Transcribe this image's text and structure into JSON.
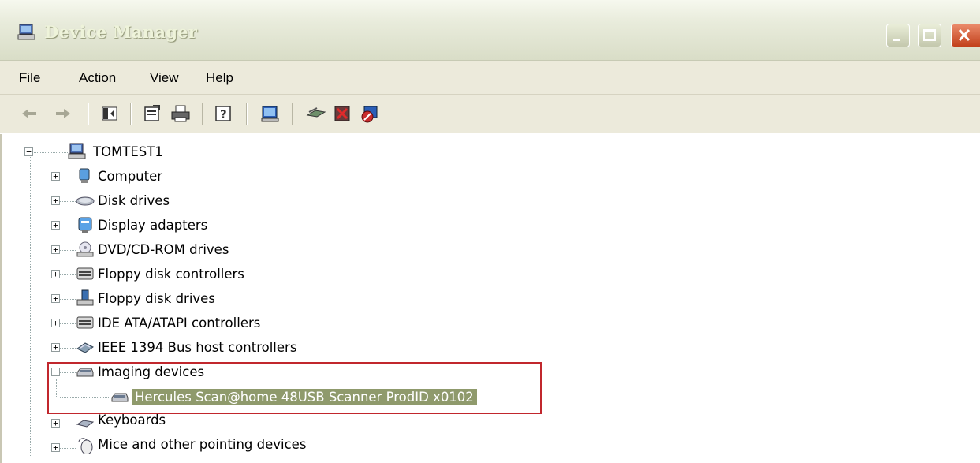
{
  "window": {
    "title": "Device Manager",
    "controls": [
      "minimize",
      "maximize",
      "close"
    ]
  },
  "menu": [
    "File",
    "Action",
    "View",
    "Help"
  ],
  "toolbar": {
    "buttons": [
      "back-icon",
      "forward-icon",
      "show-hide-console-tree-icon",
      "properties-icon",
      "print-icon",
      "help-icon",
      "scan-hardware-icon",
      "update-driver-icon",
      "uninstall-icon",
      "disable-icon"
    ]
  },
  "tree": {
    "root": "TOMTEST1",
    "categories": [
      {
        "label": "Computer",
        "icon": "computer-icon",
        "expanded": false
      },
      {
        "label": "Disk drives",
        "icon": "disk-drive-icon",
        "expanded": false
      },
      {
        "label": "Display adapters",
        "icon": "display-adapter-icon",
        "expanded": false
      },
      {
        "label": "DVD/CD-ROM drives",
        "icon": "dvd-drive-icon",
        "expanded": false
      },
      {
        "label": "Floppy disk controllers",
        "icon": "floppy-controller-icon",
        "expanded": false
      },
      {
        "label": "Floppy disk drives",
        "icon": "floppy-drive-icon",
        "expanded": false
      },
      {
        "label": "IDE ATA/ATAPI controllers",
        "icon": "ide-controller-icon",
        "expanded": false
      },
      {
        "label": "IEEE 1394 Bus host controllers",
        "icon": "ieee1394-icon",
        "expanded": false
      },
      {
        "label": "Imaging devices",
        "icon": "imaging-device-icon",
        "expanded": true,
        "children": [
          {
            "label": "Hercules Scan@home 48USB Scanner ProdID x0102",
            "icon": "scanner-icon",
            "selected": true
          }
        ]
      },
      {
        "label": "Keyboards",
        "icon": "keyboard-icon",
        "expanded": false
      },
      {
        "label": "Mice and other pointing devices",
        "icon": "mouse-icon",
        "expanded": false
      }
    ]
  },
  "colors": {
    "selection_bg": "#8f9a6c",
    "highlight_border": "#c1272d"
  }
}
